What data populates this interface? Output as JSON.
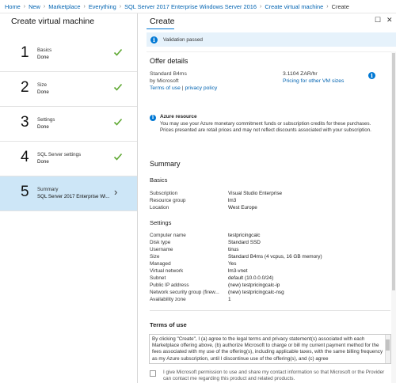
{
  "breadcrumb": [
    "Home",
    "New",
    "Marketplace",
    "Everything",
    "SQL Server 2017 Enterprise Windows Server 2016",
    "Create virtual machine",
    "Create"
  ],
  "wizard": {
    "title": "Create virtual machine",
    "steps": [
      {
        "number": "1",
        "title": "Basics",
        "subtitle": "Done",
        "status": "done"
      },
      {
        "number": "2",
        "title": "Size",
        "subtitle": "Done",
        "status": "done"
      },
      {
        "number": "3",
        "title": "Settings",
        "subtitle": "Done",
        "status": "done"
      },
      {
        "number": "4",
        "title": "SQL Server settings",
        "subtitle": "Done",
        "status": "done"
      },
      {
        "number": "5",
        "title": "Summary",
        "subtitle": "SQL Server 2017 Enterprise Wi...",
        "status": "active"
      }
    ]
  },
  "blade": {
    "title": "Create",
    "banner": "Validation passed",
    "offer": {
      "heading": "Offer details",
      "name": "Standard B4ms",
      "publisher": "by Microsoft",
      "terms_link": "Terms of use",
      "privacy_link": "privacy policy",
      "link_separator": "|",
      "price": "3.1104 ZAR/hr",
      "pricing_link": "Pricing for other VM sizes"
    },
    "azure": {
      "title": "Azure resource",
      "text": "You may use your Azure monetary commitment funds or subscription credits for these purchases. Prices presented are retail prices and may not reflect discounts associated with your subscription."
    },
    "summary": {
      "heading": "Summary",
      "basics": {
        "heading": "Basics",
        "rows": [
          {
            "label": "Subscription",
            "value": "Visual Studio Enterprise"
          },
          {
            "label": "Resource group",
            "value": "lm3"
          },
          {
            "label": "Location",
            "value": "West Europe"
          }
        ]
      },
      "settings": {
        "heading": "Settings",
        "rows": [
          {
            "label": "Computer name",
            "value": "testpricingcalc"
          },
          {
            "label": "Disk type",
            "value": "Standard SSD"
          },
          {
            "label": "Username",
            "value": "tinus"
          },
          {
            "label": "Size",
            "value": "Standard B4ms (4 vcpus, 16 GB memory)"
          },
          {
            "label": "Managed",
            "value": "Yes"
          },
          {
            "label": "Virtual network",
            "value": "lm3-vnet"
          },
          {
            "label": "Subnet",
            "value": "default (10.0.0.0/24)"
          },
          {
            "label": "Public IP address",
            "value": "(new) testpricingcalc-ip"
          },
          {
            "label": "Network security group (firew...",
            "value": "(new) testpricingcalc-nsg"
          },
          {
            "label": "Availability zone",
            "value": "1"
          }
        ]
      }
    },
    "terms": {
      "heading": "Terms of use",
      "text": "By clicking \"Create\", I (a) agree to the legal terms and privacy statement(s) associated with each Marketplace offering above, (b) authorize Microsoft to charge or bill my current payment method for the fees associated with my use of the offering(s), including applicable taxes, with the same billing frequency as my Azure subscription, until I discontinue use of the offering(s), and (c) agree",
      "consent": "I give Microsoft permission to use and share my contact information so that Microsoft or the Provider can contact me regarding this product and related products."
    }
  },
  "colors": {
    "accent": "#0078d4",
    "check": "#5ea832",
    "active_step_bg": "#cde6f7",
    "banner_bg": "#e6f2fb"
  }
}
